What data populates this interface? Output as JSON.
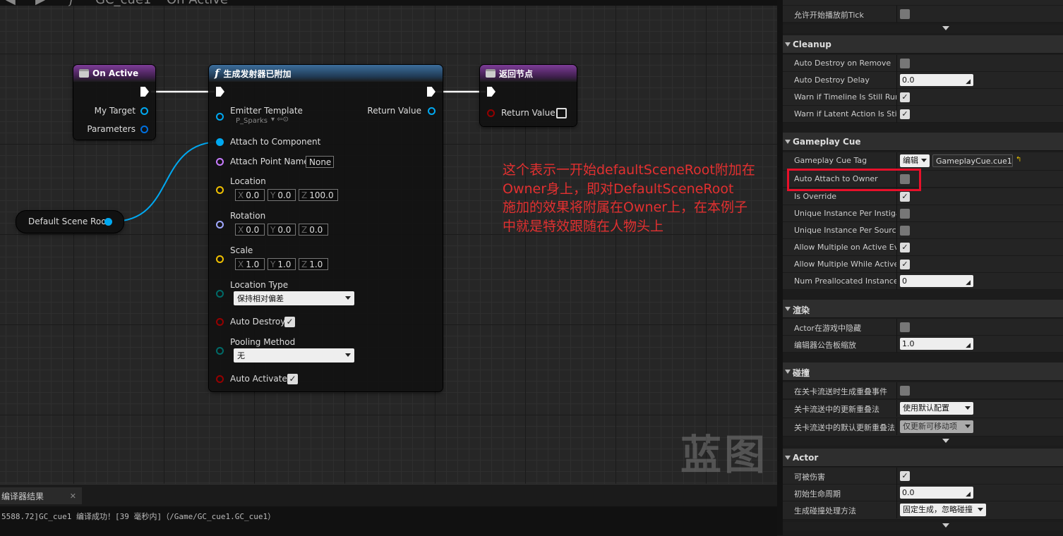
{
  "graph": {
    "breadcrumb": {
      "asset": "GC_cue1",
      "function": "On Active"
    },
    "watermark": "蓝图",
    "on_active": {
      "title": "On Active",
      "pins": [
        "My Target",
        "Parameters"
      ]
    },
    "spawn": {
      "title": "生成发射器已附加",
      "return_value": "Return Value",
      "emitter_template": {
        "label": "Emitter Template",
        "value": "P_Sparks"
      },
      "attach_to_component": "Attach to Component",
      "attach_point_name": {
        "label": "Attach Point Name",
        "value": "None"
      },
      "location": {
        "label": "Location",
        "x": "0.0",
        "y": "0.0",
        "z": "100.0"
      },
      "rotation": {
        "label": "Rotation",
        "x": "0.0",
        "y": "0.0",
        "z": "0.0"
      },
      "scale": {
        "label": "Scale",
        "x": "1.0",
        "y": "1.0",
        "z": "1.0"
      },
      "axis": {
        "x": "X",
        "y": "Y",
        "z": "Z"
      },
      "location_type": {
        "label": "Location Type",
        "value": "保持相对偏差"
      },
      "auto_destroy": {
        "label": "Auto Destroy",
        "checked": true
      },
      "pooling_method": {
        "label": "Pooling Method",
        "value": "无"
      },
      "auto_activate": {
        "label": "Auto Activate",
        "checked": true
      }
    },
    "return_node": {
      "title": "返回节点",
      "return_value": "Return Value"
    },
    "scene_root": {
      "label": "Default Scene Root"
    },
    "annotation": [
      "这个表示一开始defaultSceneRoot附加在",
      "Owner身上，即对DefaultSceneRoot",
      "施加的效果将附属在Owner上，在本例子",
      "中就是特效跟随在人物头上"
    ]
  },
  "bottom": {
    "tab_label": "编译器结果",
    "log_line": "5588.72]GC_cue1 编译成功！[39 毫秒内]（/Game/GC_cue1.GC_cue1）"
  },
  "details": {
    "top_row": {
      "label": "允许开始播放前Tick",
      "checked": false
    },
    "cleanup": {
      "title": "Cleanup",
      "rows": [
        {
          "label": "Auto Destroy on Remove",
          "type": "check",
          "checked": false
        },
        {
          "label": "Auto Destroy Delay",
          "type": "number",
          "value": "0.0"
        },
        {
          "label": "Warn if Timeline Is Still Running",
          "type": "check",
          "checked": true
        },
        {
          "label": "Warn if Latent Action Is Still Running",
          "type": "check",
          "checked": true
        }
      ]
    },
    "gameplay_cue": {
      "title": "Gameplay Cue",
      "tag": {
        "label": "Gameplay Cue Tag",
        "edit": "编辑",
        "value": "GameplayCue.cue1"
      },
      "rows": [
        {
          "label": "Auto Attach to Owner",
          "type": "check",
          "checked": false
        },
        {
          "label": "Is Override",
          "type": "check",
          "checked": true
        },
        {
          "label": "Unique Instance Per Instigator",
          "type": "check",
          "checked": false
        },
        {
          "label": "Unique Instance Per Source Object",
          "type": "check",
          "checked": false
        },
        {
          "label": "Allow Multiple on Active Events",
          "type": "check",
          "checked": true
        },
        {
          "label": "Allow Multiple While Active Events",
          "type": "check",
          "checked": true
        },
        {
          "label": "Num Preallocated Instances",
          "type": "number",
          "value": "0"
        }
      ]
    },
    "rendering": {
      "title": "渲染",
      "rows": [
        {
          "label": "Actor在游戏中隐藏",
          "type": "check",
          "checked": false
        },
        {
          "label": "编辑器公告板缩放",
          "type": "number",
          "value": "1.0"
        }
      ]
    },
    "collision": {
      "title": "碰撞",
      "rows": [
        {
          "label": "在关卡流送时生成重叠事件",
          "type": "check",
          "checked": false
        },
        {
          "label": "关卡流送中的更新重叠法",
          "type": "dropdown",
          "value": "使用默认配置"
        },
        {
          "label": "关卡流送中的默认更新重叠法",
          "type": "dropdown",
          "value": "仅更新可移动项"
        }
      ]
    },
    "actor": {
      "title": "Actor",
      "rows": [
        {
          "label": "可被伤害",
          "type": "check",
          "checked": true
        },
        {
          "label": "初始生命周期",
          "type": "number",
          "value": "0.0"
        },
        {
          "label": "生成碰撞处理方法",
          "type": "dropdown",
          "value": "固定生成，忽略碰撞"
        }
      ]
    }
  },
  "colors": {
    "exec": "#ffffff",
    "object_pin": "#00a8f0",
    "name_pin": "#c87cff",
    "vector_pin": "#f0c000",
    "rotator_pin": "#a0a8ff",
    "bool_pin": "#950000",
    "enum_pin": "#006a68",
    "annotation": "#e23030",
    "highlight": "#e8102a"
  }
}
